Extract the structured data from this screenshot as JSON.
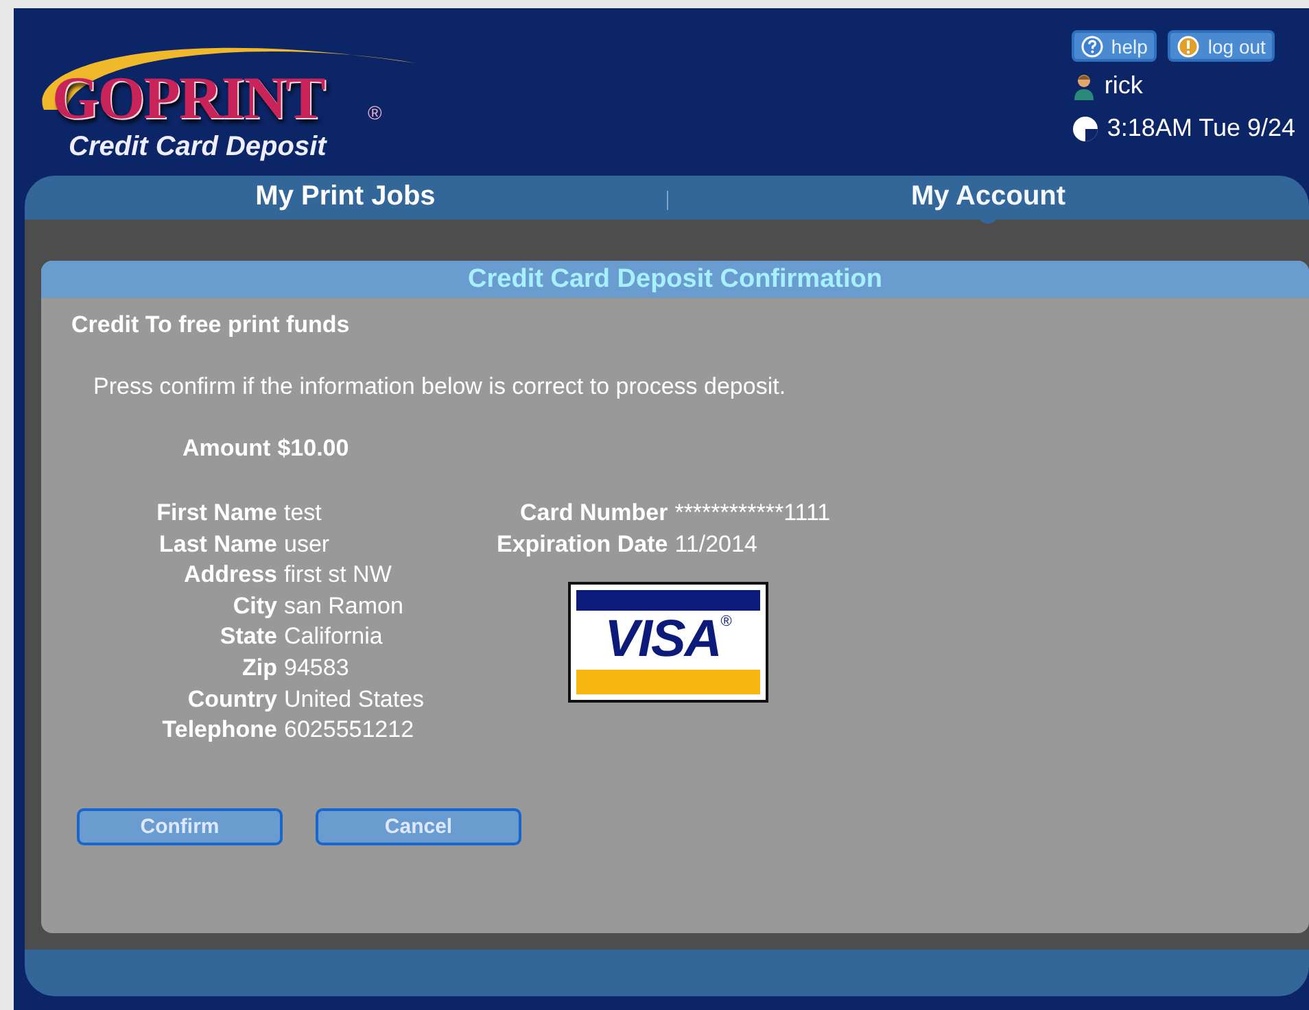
{
  "header": {
    "logo": "GOPRINT",
    "logo_mark": "®",
    "subtitle": "Credit Card Deposit",
    "buttons": [
      {
        "kind": "help",
        "label": "help"
      },
      {
        "kind": "logout",
        "label": "log out"
      }
    ],
    "user": "rick",
    "time": "3:18AM Tue 9/24"
  },
  "tabs": [
    {
      "label": "My Print Jobs",
      "selected": false
    },
    {
      "label": "My Account",
      "selected": true
    }
  ],
  "panel": {
    "title": "Credit Card Deposit Confirmation",
    "section": "Credit To free print funds",
    "instruction": "Press confirm if the information below is correct to process deposit.",
    "amount_label": "Amount",
    "amount": "$10.00",
    "fields": [
      {
        "label": "First Name",
        "value": "test"
      },
      {
        "label": "Last Name",
        "value": "user"
      },
      {
        "label": "Address",
        "value": "first st NW"
      },
      {
        "label": "City",
        "value": "san Ramon"
      },
      {
        "label": "State",
        "value": "California"
      },
      {
        "label": "Zip",
        "value": "94583"
      },
      {
        "label": "Country",
        "value": "United States"
      },
      {
        "label": "Telephone",
        "value": "6025551212"
      }
    ],
    "card_fields": [
      {
        "label": "Card Number",
        "value": "************1111"
      },
      {
        "label": "Expiration Date",
        "value": "11/2014"
      }
    ],
    "card_brand": "VISA",
    "card_brand_mark": "®",
    "buttons": [
      "Confirm",
      "Cancel"
    ]
  }
}
